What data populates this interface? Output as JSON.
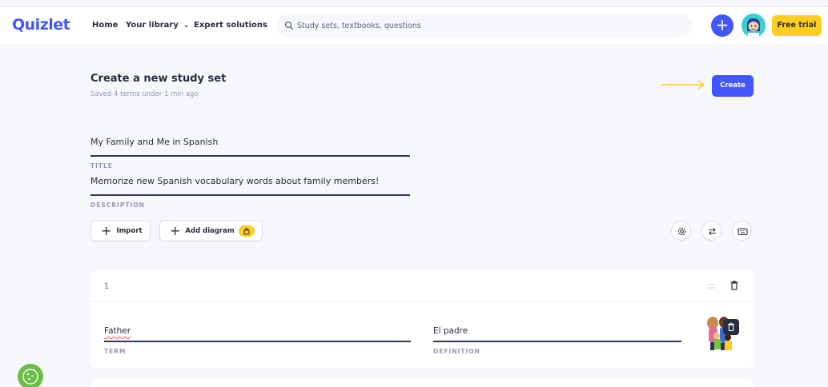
{
  "header": {
    "logo": "Quizlet",
    "nav": {
      "home": "Home",
      "library": "Your library",
      "expert": "Expert solutions"
    },
    "search_placeholder": "Study sets, textbooks, questions",
    "free_trial": "Free trial"
  },
  "page": {
    "title": "Create a new study set",
    "saved_status": "Saved 4 terms under 1 min ago",
    "create_label": "Create"
  },
  "form": {
    "title_value": "My Family and Me in Spanish",
    "title_label": "TITLE",
    "description_value": "Memorize new Spanish vocabulary words about family members!",
    "description_label": "DESCRIPTION"
  },
  "actions": {
    "import_label": "Import",
    "add_diagram_label": "Add diagram"
  },
  "cards": [
    {
      "number": "1",
      "term": "Father",
      "term_label": "TERM",
      "definition": "El padre",
      "definition_label": "DEFINITION"
    }
  ],
  "colors": {
    "brand": "#4255ff",
    "accent_yellow": "#ffcd1f",
    "text": "#282e3e",
    "muted": "#939bb4",
    "background": "#f6f7fb"
  },
  "icons": [
    "search-icon",
    "chevron-down-icon",
    "plus-icon",
    "lock-icon",
    "settings-icon",
    "swap-icon",
    "keyboard-icon",
    "drag-handle-icon",
    "trash-icon",
    "cookie-icon"
  ]
}
